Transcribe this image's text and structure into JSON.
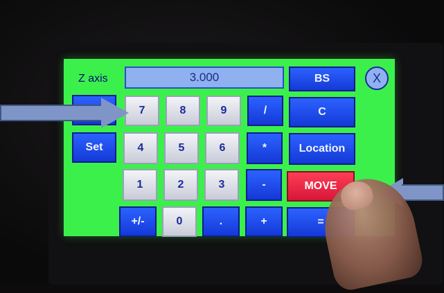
{
  "screen": {
    "axis_label": "Z axis",
    "display_value": "3.000",
    "close_label": "X"
  },
  "side_buttons": {
    "top_label": "",
    "set_label": "Set"
  },
  "keypad": {
    "row1": [
      "7",
      "8",
      "9",
      "/"
    ],
    "row2": [
      "4",
      "5",
      "6",
      "*"
    ],
    "row3": [
      "1",
      "2",
      "3",
      "-"
    ],
    "row4": [
      "+/-",
      "0",
      ".",
      "+"
    ]
  },
  "right_buttons": {
    "bs": "BS",
    "clear": "C",
    "location": "Location",
    "move": "MOVE",
    "equals": "="
  },
  "colors": {
    "screen_bg": "#3cf04c",
    "button_blue": "#1f4cf0",
    "key_white": "#e6e8f0",
    "move_red": "#e8213f",
    "display_bg": "#8fb1f0"
  }
}
